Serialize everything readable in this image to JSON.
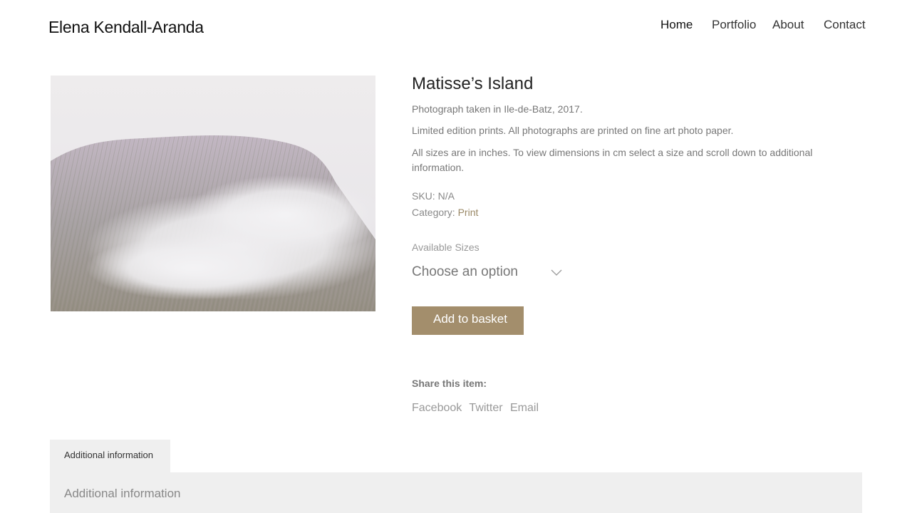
{
  "site": {
    "title": "Elena Kendall-Aranda"
  },
  "nav": {
    "items": [
      {
        "label": "Home"
      },
      {
        "label": "Portfolio"
      },
      {
        "label": "About"
      },
      {
        "label": "Contact"
      }
    ]
  },
  "product": {
    "title": "Matisse’s Island",
    "description_1": "Photograph taken in Ile-de-Batz, 2017.",
    "description_2": "Limited edition prints. All photographs are printed on fine art photo paper.",
    "description_3": "All sizes are in inches. To view dimensions in cm select a size and scroll down to additional information.",
    "sku_label": "SKU:",
    "sku_value": "N/A",
    "category_label": "Category:",
    "category_value": "Print",
    "sizes_label": "Available Sizes",
    "size_select_placeholder": "Choose an option",
    "add_to_basket": "Add to basket",
    "image_icon": "misty-grass-photo"
  },
  "share": {
    "label": "Share this item:",
    "links": [
      "Facebook",
      "Twitter",
      "Email"
    ]
  },
  "tabs": {
    "items": [
      {
        "label": "Additional information"
      }
    ],
    "panel_heading": "Additional information"
  },
  "colors": {
    "button": "#a38e6c",
    "tab_bg": "#efefef",
    "link_muted": "#9a8866"
  }
}
